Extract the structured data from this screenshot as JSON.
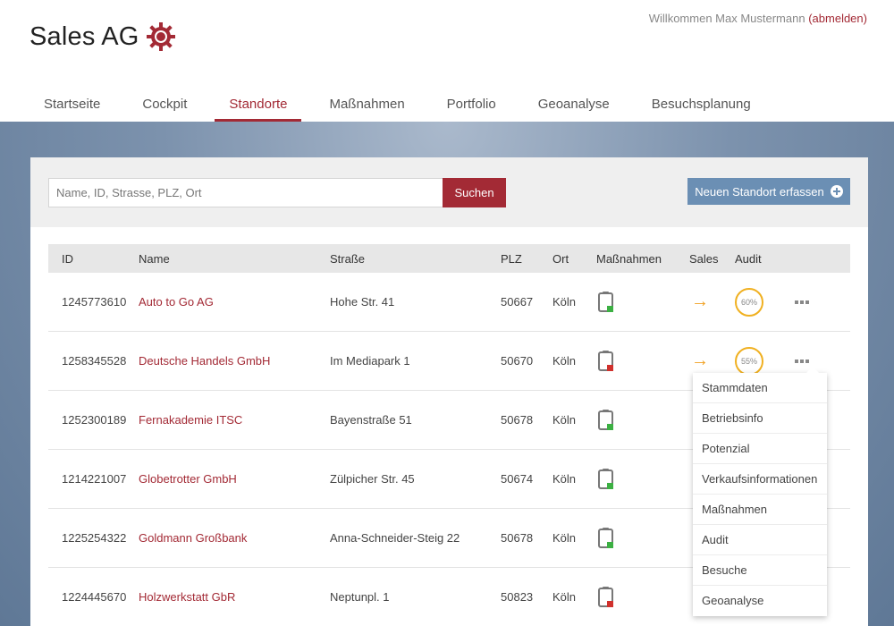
{
  "app": {
    "name": "Sales AG"
  },
  "welcome": {
    "text": "Willkommen Max Mustermann ",
    "logout": "abmelden"
  },
  "nav": {
    "tabs": [
      {
        "label": "Startseite"
      },
      {
        "label": "Cockpit"
      },
      {
        "label": "Standorte",
        "active": true
      },
      {
        "label": "Maßnahmen"
      },
      {
        "label": "Portfolio"
      },
      {
        "label": "Geoanalyse"
      },
      {
        "label": "Besuchsplanung"
      }
    ]
  },
  "search": {
    "placeholder": "Name, ID, Strasse, PLZ, Ort",
    "value": "",
    "button_label": "Suchen"
  },
  "new_location": {
    "label": "Neuen Standort erfassen",
    "icon": "plus-circle-icon"
  },
  "table": {
    "headers": [
      "ID",
      "Name",
      "Straße",
      "PLZ",
      "Ort",
      "Maßnahmen",
      "Sales",
      "Audit"
    ],
    "rows": [
      {
        "id": "1245773610",
        "name": "Auto to Go AG",
        "street": "Hohe Str. 41",
        "plz": "50667",
        "ort": "Köln",
        "status_color": "#3cb043",
        "sales": true,
        "audit": "60%"
      },
      {
        "id": "1258345528",
        "name": "Deutsche Handels GmbH",
        "street": "Im Mediapark 1",
        "plz": "50670",
        "ort": "Köln",
        "status_color": "#d0312d",
        "sales": true,
        "audit": "55%"
      },
      {
        "id": "1252300189",
        "name": "Fernakademie ITSC",
        "street": "Bayenstraße 51",
        "plz": "50678",
        "ort": "Köln",
        "status_color": "#3cb043"
      },
      {
        "id": "1214221007",
        "name": "Globetrotter GmbH",
        "street": "Zülpicher Str. 45",
        "plz": "50674",
        "ort": "Köln",
        "status_color": "#3cb043"
      },
      {
        "id": "1225254322",
        "name": "Goldmann Großbank",
        "street": "Anna-Schneider-Steig 22",
        "plz": "50678",
        "ort": "Köln",
        "status_color": "#3cb043"
      },
      {
        "id": "1224445670",
        "name": "Holzwerkstatt GbR",
        "street": "Neptunpl. 1",
        "plz": "50823",
        "ort": "Köln",
        "status_color": "#d0312d"
      }
    ]
  },
  "context_menu": {
    "items": [
      "Stammdaten",
      "Betriebsinfo",
      "Potenzial",
      "Verkaufsinformationen",
      "Maßnahmen",
      "Audit",
      "Besuche",
      "Geoanalyse"
    ]
  },
  "colors": {
    "brand": "#a32a35",
    "accent_blue": "#6b8fb4",
    "audit_ring": "#f0b020",
    "arrow": "#f0a020"
  }
}
